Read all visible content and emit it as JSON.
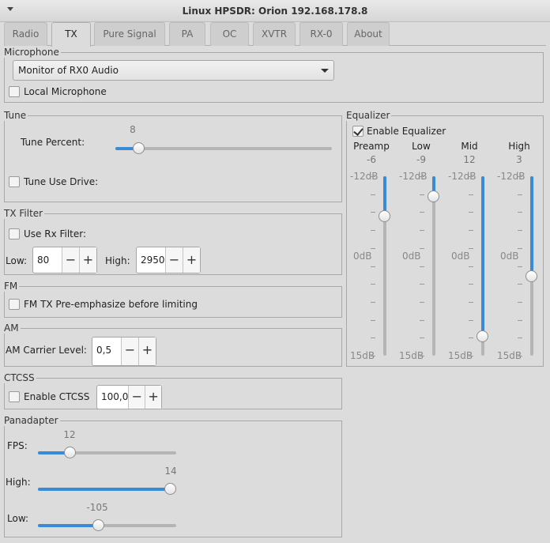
{
  "window": {
    "title": "Linux HPSDR: Orion 192.168.178.8"
  },
  "tabs": [
    {
      "label": "Radio"
    },
    {
      "label": "TX"
    },
    {
      "label": "Pure Signal"
    },
    {
      "label": "PA"
    },
    {
      "label": "OC"
    },
    {
      "label": "XVTR"
    },
    {
      "label": "RX-0"
    },
    {
      "label": "About"
    }
  ],
  "active_tab": "TX",
  "microphone": {
    "legend": "Microphone",
    "source_selected": "Monitor of RX0 Audio",
    "local_mic_label": "Local Microphone",
    "local_mic_checked": false
  },
  "tune": {
    "legend": "Tune",
    "percent_label": "Tune Percent:",
    "percent_value": "8",
    "percent_fraction": 0.08,
    "use_drive_label": "Tune Use Drive:",
    "use_drive_checked": false
  },
  "tx_filter": {
    "legend": "TX Filter",
    "use_rx_label": "Use Rx Filter:",
    "use_rx_checked": false,
    "low_label": "Low:",
    "low_value": "80",
    "high_label": "High:",
    "high_value": "2950"
  },
  "fm": {
    "legend": "FM",
    "preemph_label": "FM TX Pre-emphasize before limiting",
    "preemph_checked": false
  },
  "am": {
    "legend": "AM",
    "carrier_label": "AM Carrier Level:",
    "carrier_value": "0,5"
  },
  "ctcss": {
    "legend": "CTCSS",
    "enable_label": "Enable CTCSS",
    "enable_checked": false,
    "freq_value": "100,0"
  },
  "panadapter": {
    "legend": "Panadapter",
    "fps_label": "FPS:",
    "fps_value": "12",
    "fps_fraction": 0.2,
    "high_label": "High:",
    "high_value": "14",
    "high_fraction": 1.0,
    "low_label": "Low:",
    "low_value": "-105",
    "low_fraction": 0.43
  },
  "equalizer": {
    "legend": "Equalizer",
    "enable_label": "Enable Equalizer",
    "enable_checked": true,
    "scale_top": "-12dB",
    "scale_mid": "0dB",
    "scale_bottom": "15dB",
    "bands": [
      {
        "name": "Preamp",
        "value": "-6",
        "level": -6
      },
      {
        "name": "Low",
        "value": "-9",
        "level": -9
      },
      {
        "name": "Mid",
        "value": "12",
        "level": 12
      },
      {
        "name": "High",
        "value": "3",
        "level": 3
      }
    ]
  },
  "icons": {
    "plus": "+",
    "minus": "−"
  },
  "colors": {
    "accent": "#3a8bd6",
    "background": "#dcdcdc"
  }
}
